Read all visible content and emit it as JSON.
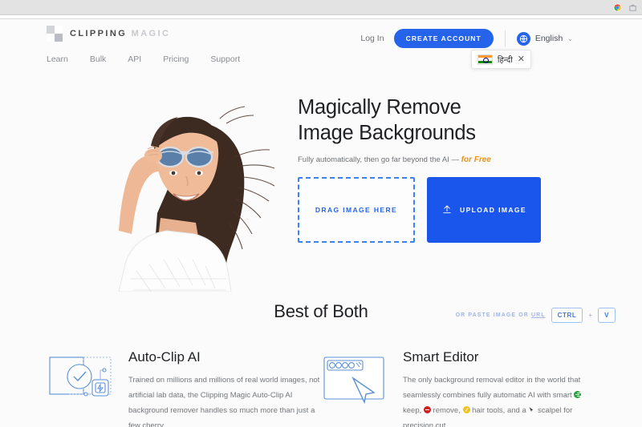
{
  "browser": {
    "icons": [
      "chrome-profile-icon",
      "extensions-icon"
    ]
  },
  "header": {
    "logo": {
      "primary": "CLIPPING",
      "secondary": "MAGIC",
      "icon": "checkerboard-logo-icon"
    },
    "nav": [
      {
        "label": "Learn"
      },
      {
        "label": "Bulk"
      },
      {
        "label": "API"
      },
      {
        "label": "Pricing"
      },
      {
        "label": "Support"
      }
    ],
    "login_label": "Log In",
    "create_account_label": "CREATE ACCOUNT",
    "language": {
      "icon": "globe-icon",
      "current": "English",
      "caret": "⌄"
    },
    "language_popup": {
      "flag": "india-flag-icon",
      "label": "हिन्दी",
      "close": "✕"
    }
  },
  "hero": {
    "photo_alt": "woman-with-sunglasses-cutout",
    "title_line1": "Magically Remove",
    "title_line2": "Image Backgrounds",
    "subtitle_prefix": "Fully automatically, then go far beyond the AI — ",
    "subtitle_highlight": "for Free",
    "drop_zone_label": "DRAG IMAGE HERE",
    "upload_label": "UPLOAD IMAGE",
    "upload_icon": "upload-arrow-icon",
    "paste": {
      "text_before": "OR PASTE IMAGE OR ",
      "link": "URL",
      "key1": "CTRL",
      "plus": "+",
      "key2": "V"
    }
  },
  "best_of_both": {
    "title": "Best of Both",
    "features": [
      {
        "art": "auto-clip-ai-illustration",
        "title": "Auto-Clip AI",
        "text": "Trained on millions and millions of real world images, not artificial lab data, the Clipping Magic Auto-Clip AI background remover handles so much more than just a few cherry"
      },
      {
        "art": "smart-editor-illustration",
        "title": "Smart Editor",
        "text_part1": "The only background removal editor in the world that seamlessly combines fully automatic AI with smart ",
        "keep_label": " keep, ",
        "remove_label": " remove, ",
        "hair_label": " hair tools, and a ",
        "scalpel_label": " scalpel for precision cut",
        "badges": {
          "keep": "#23a23a",
          "remove": "#cf2020",
          "hair": "#f2c21a",
          "scalpel": "scalpel-cursor-icon"
        }
      }
    ]
  },
  "colors": {
    "brand_blue": "#2563eb",
    "upload_blue": "#1a56eb",
    "accent_orange": "#e8941a",
    "page_bg": "#fbfbfb"
  }
}
